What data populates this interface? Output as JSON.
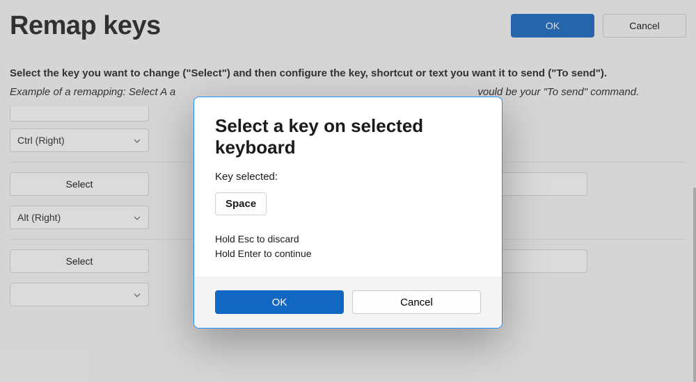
{
  "header": {
    "title": "Remap keys",
    "ok_label": "OK",
    "cancel_label": "Cancel"
  },
  "intro": "Select the key you want to change (\"Select\") and then configure the key, shortcut or text you want it to send (\"To send\").",
  "example_prefix": "Example of a remapping: Select A a",
  "example_suffix": "vould be your \"To send\" command.",
  "rows": [
    {
      "left_select_visible": false,
      "left_key": "Ctrl (Right)",
      "right_select_visible": false,
      "right_key": ""
    },
    {
      "left_select_visible": true,
      "left_key": "Alt (Right)",
      "right_select_visible": true,
      "right_key": ""
    },
    {
      "left_select_visible": true,
      "left_key": "",
      "right_select_visible": true,
      "right_key": ""
    }
  ],
  "select_label": "Select",
  "dialog": {
    "title": "Select a key on selected keyboard",
    "key_selected_label": "Key selected:",
    "selected_key": "Space",
    "hint1": "Hold Esc to discard",
    "hint2": "Hold Enter to continue",
    "ok_label": "OK",
    "cancel_label": "Cancel"
  }
}
